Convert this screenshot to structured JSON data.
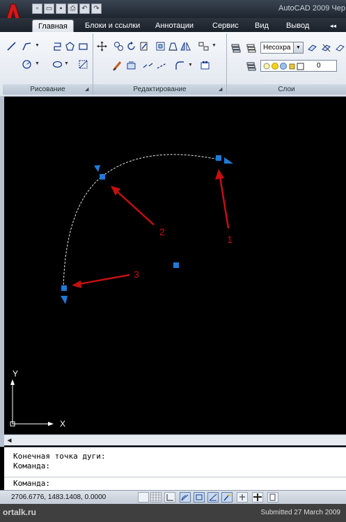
{
  "app": {
    "title": "AutoCAD 2009 Чер",
    "logo_letter": "A"
  },
  "quick_access": {
    "icons": [
      "new-file-icon",
      "open-file-icon",
      "save-icon",
      "print-icon",
      "undo-icon",
      "redo-icon"
    ]
  },
  "tabs": [
    {
      "label": "Главная",
      "active": true
    },
    {
      "label": "Блоки и ссылки",
      "active": false
    },
    {
      "label": "Аннотации",
      "active": false
    },
    {
      "label": "Сервис",
      "active": false
    },
    {
      "label": "Вид",
      "active": false
    },
    {
      "label": "Вывод",
      "active": false
    }
  ],
  "ribbon": {
    "panels": [
      {
        "title": "Рисование"
      },
      {
        "title": "Редактирование"
      },
      {
        "title": "Слои"
      }
    ],
    "layer_combo": "Несохра",
    "current_layer": "0"
  },
  "canvas": {
    "background": "#000000",
    "grip_color": "#1e7bd8",
    "arrow_color": "#c41010",
    "labels": [
      "1",
      "2",
      "3"
    ],
    "ucs_x": "X",
    "ucs_y": "Y"
  },
  "command_window": {
    "lines": [
      "Конечная точка дуги:",
      "Команда:"
    ],
    "prompt": "Команда:"
  },
  "statusbar": {
    "coordinates": "2706.6776, 1483.1408, 0.0000"
  },
  "footer": {
    "logo": "ortalk.ru",
    "note": "Submitted 27 March 2009"
  }
}
